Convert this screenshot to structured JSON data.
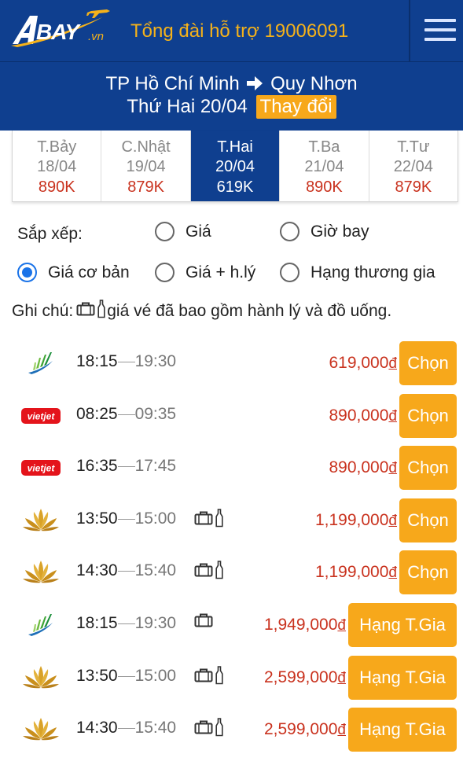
{
  "header": {
    "logo_text": "BAY",
    "logo_suffix": ".vn",
    "hotline": "Tổng đài hỗ trợ 19006091"
  },
  "route": {
    "from": "TP Hồ Chí Minh",
    "to": "Quy Nhơn",
    "date": "Thứ Hai 20/04",
    "change_label": "Thay đổi"
  },
  "date_tabs": [
    {
      "day": "T.Bảy",
      "date": "18/04",
      "price": "890K",
      "active": false
    },
    {
      "day": "C.Nhật",
      "date": "19/04",
      "price": "879K",
      "active": false
    },
    {
      "day": "T.Hai",
      "date": "20/04",
      "price": "619K",
      "active": true
    },
    {
      "day": "T.Ba",
      "date": "21/04",
      "price": "890K",
      "active": false
    },
    {
      "day": "T.Tư",
      "date": "22/04",
      "price": "879K",
      "active": false
    }
  ],
  "sort": {
    "label": "Sắp xếp:",
    "options": [
      {
        "label": "Giá",
        "checked": false
      },
      {
        "label": "Giờ bay",
        "checked": false
      },
      {
        "label": "Giá cơ bản",
        "checked": true
      },
      {
        "label": "Giá + h.lý",
        "checked": false
      },
      {
        "label": "Hạng thương gia",
        "checked": false
      }
    ]
  },
  "note": {
    "prefix": "Ghi chú:",
    "text": "giá vé đã bao gồm hành lý và đồ uống."
  },
  "colors": {
    "navy": "#0f3f8f",
    "orange": "#f7a81b",
    "price_red": "#c9321e",
    "radio_blue": "#1a73e8"
  },
  "flights": [
    {
      "airline": "bamboo",
      "dep": "18:15",
      "arr": "19:30",
      "bags": "",
      "price": "619,000",
      "currency": "đ",
      "button": "Chọn"
    },
    {
      "airline": "vietjet",
      "dep": "08:25",
      "arr": "09:35",
      "bags": "",
      "price": "890,000",
      "currency": "đ",
      "button": "Chọn"
    },
    {
      "airline": "vietjet",
      "dep": "16:35",
      "arr": "17:45",
      "bags": "",
      "price": "890,000",
      "currency": "đ",
      "button": "Chọn"
    },
    {
      "airline": "vietnam-airlines",
      "dep": "13:50",
      "arr": "15:00",
      "bags": "luggage-drink",
      "price": "1,199,000",
      "currency": "đ",
      "button": "Chọn"
    },
    {
      "airline": "vietnam-airlines",
      "dep": "14:30",
      "arr": "15:40",
      "bags": "luggage-drink",
      "price": "1,199,000",
      "currency": "đ",
      "button": "Chọn"
    },
    {
      "airline": "bamboo",
      "dep": "18:15",
      "arr": "19:30",
      "bags": "luggage",
      "price": "1,949,000",
      "currency": "đ",
      "button": "Hạng T.Gia"
    },
    {
      "airline": "vietnam-airlines",
      "dep": "13:50",
      "arr": "15:00",
      "bags": "luggage-drink",
      "price": "2,599,000",
      "currency": "đ",
      "button": "Hạng T.Gia"
    },
    {
      "airline": "vietnam-airlines",
      "dep": "14:30",
      "arr": "15:40",
      "bags": "luggage-drink",
      "price": "2,599,000",
      "currency": "đ",
      "button": "Hạng T.Gia"
    }
  ]
}
